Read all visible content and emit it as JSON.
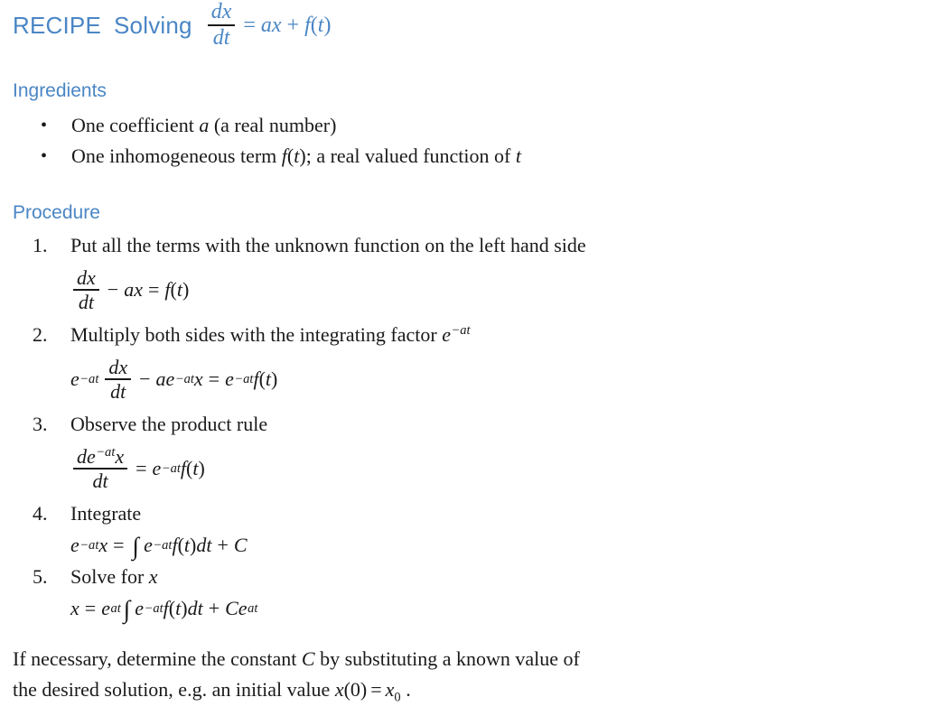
{
  "document": {
    "background_color": "#ffffff",
    "accent_color": "#4a86c5",
    "text_color": "#1a1a1a"
  },
  "title": {
    "recipe_label": "RECIPE",
    "solving_label": "Solving",
    "equation_plain": "dx/dt = ax + f(t)",
    "fraction_numerator": "dx",
    "fraction_denominator": "dt",
    "equals": "=",
    "rhs_a": "a",
    "rhs_x": "x",
    "plus": "+",
    "rhs_f": "f",
    "rhs_open": "(",
    "rhs_t": "t",
    "rhs_close": ")"
  },
  "ingredients": {
    "heading": "Ingredients",
    "bullet_glyph": "•",
    "items": [
      {
        "prefix": "One coefficient ",
        "symbol": "a",
        "suffix": " (a real number)"
      },
      {
        "prefix": "One inhomogeneous term ",
        "symbol": "f",
        "open": "(",
        "arg": "t",
        "close": ")",
        "suffix": "; a real valued function of ",
        "tail_symbol": "t"
      }
    ]
  },
  "procedure": {
    "heading": "Procedure",
    "steps": [
      {
        "number": "1.",
        "text": "Put all the terms with the unknown function on the left hand side",
        "equation_plain": "dx/dt − ax = f(t)"
      },
      {
        "number": "2.",
        "text_before": "Multiply both sides with the integrating factor ",
        "text_symbol_base": "e",
        "text_symbol_exp": "−at",
        "equation_plain": "e^(−at) dx/dt − ae^(−at)x = e^(−at)f(t)"
      },
      {
        "number": "3.",
        "text": "Observe the product rule",
        "equation_plain": "d e^(−at)x / dt = e^(−at)f(t)"
      },
      {
        "number": "4.",
        "text": "Integrate",
        "equation_plain": "e^(−at)x = ∫ e^(−at)f(t)dt + C"
      },
      {
        "number": "5.",
        "text_before": "Solve for ",
        "text_symbol": "x",
        "equation_plain": "x = e^(at) ∫ e^(−at)f(t)dt + Ce^(at)"
      }
    ],
    "math_tokens": {
      "d": "d",
      "x": "x",
      "t": "t",
      "a": "a",
      "e": "e",
      "f": "f",
      "C": "C",
      "dx": "dx",
      "dt": "dt",
      "de": "de",
      "minus": "−",
      "equals": "=",
      "plus": "+",
      "open_paren": "(",
      "close_paren": ")",
      "integral": "∫",
      "exp_neg_at": "−at",
      "exp_at": "at"
    }
  },
  "closing": {
    "line1_a": "If necessary, determine the constant ",
    "line1_symbol": "C",
    "line1_b": " by substituting a known value of",
    "line2_a": "the desired solution, e.g. an initial value ",
    "line2_x": "x",
    "line2_open": "(",
    "line2_zero": "0",
    "line2_close": ")",
    "line2_equals": "=",
    "line2_x2": "x",
    "line2_sub": "0",
    "line2_period": "."
  }
}
